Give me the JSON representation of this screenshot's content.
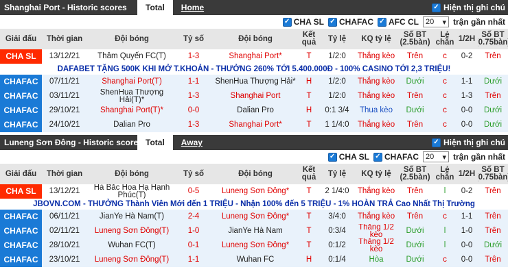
{
  "colors": {
    "cha_sl": "#ff2a00",
    "chafac": "#1a7ad6",
    "red_text": "#e00000",
    "green_text": "#2a9d2a"
  },
  "panel1": {
    "title": "Shanghai Port - Historic scores",
    "tabs": [
      "Total",
      "Home"
    ],
    "show_notes": "Hiện thị ghi chú",
    "filters": [
      "CHA SL",
      "CHAFAC",
      "AFC CL"
    ],
    "count_value": "20",
    "count_label": "trận gần nhất",
    "headers": [
      "Giải đấu",
      "Thời gian",
      "Đội bóng",
      "Tỷ số",
      "Đội bóng",
      "Kết quả",
      "Tỷ lệ",
      "KQ tỷ lệ",
      "Số BT (2.5bàn)",
      "Lẻ chẵn",
      "1/2H",
      "Số BT (0.75bàn)"
    ],
    "rows": [
      {
        "league": "CHA SL",
        "date": "13/12/21",
        "home": "Thâm Quyến FC(T)",
        "score": "1-3",
        "away": "Shanghai Port*",
        "res": "T",
        "odds": "1/2:0",
        "oddres": "Thắng kèo",
        "ou": "Trên",
        "oe": "c",
        "half": "0-2",
        "ou75": "Trên"
      },
      {
        "promo": "DAFABET TẶNG 500K KHI MỞ T.KHOẢN - THƯỞNG 260% TỚI 5.400.000Đ - 100% CASINO TỚI 2,3 TRIỆU!"
      },
      {
        "league": "CHAFAC",
        "date": "07/11/21",
        "home": "Shanghai Port(T)",
        "score": "1-1",
        "away": "ShenHua Thượng Hải*",
        "res": "H",
        "odds": "1/2:0",
        "oddres": "Thắng kèo",
        "ou": "Dưới",
        "oe": "c",
        "half": "1-1",
        "ou75": "Dưới"
      },
      {
        "league": "CHAFAC",
        "date": "03/11/21",
        "home": "ShenHua Thượng Hải(T)*",
        "score": "1-3",
        "away": "Shanghai Port",
        "res": "T",
        "odds": "1/2:0",
        "oddres": "Thắng kèo",
        "ou": "Trên",
        "oe": "c",
        "half": "1-3",
        "ou75": "Trên"
      },
      {
        "league": "CHAFAC",
        "date": "29/10/21",
        "home": "Shanghai Port(T)*",
        "score": "0-0",
        "away": "Dalian Pro",
        "res": "H",
        "odds": "0:1 3/4",
        "oddres": "Thua kèo",
        "ou": "Dưới",
        "oe": "c",
        "half": "0-0",
        "ou75": "Dưới"
      },
      {
        "league": "CHAFAC",
        "date": "24/10/21",
        "home": "Dalian Pro",
        "score": "1-3",
        "away": "Shanghai Port*",
        "res": "T",
        "odds": "1 1/4:0",
        "oddres": "Thắng kèo",
        "ou": "Trên",
        "oe": "c",
        "half": "0-0",
        "ou75": "Dưới"
      }
    ]
  },
  "panel2": {
    "title": "Luneng Sơn Đông - Historic scores",
    "tabs": [
      "Total",
      "Away"
    ],
    "show_notes": "Hiện thị ghi chú",
    "filters": [
      "CHA SL",
      "CHAFAC"
    ],
    "count_value": "20",
    "count_label": "trận gần nhất",
    "headers": [
      "Giải đấu",
      "Thời gian",
      "Đội bóng",
      "Tỷ số",
      "Đội bóng",
      "Kết quả",
      "Tỷ lệ",
      "KQ tỷ lệ",
      "Số BT (2.5bàn)",
      "Lẻ chẵn",
      "1/2H",
      "Số BT (0.75bàn)"
    ],
    "rows": [
      {
        "league": "CHA SL",
        "date": "13/12/21",
        "home": "Hà Bắc Hoa Hạ Hạnh Phúc(T)",
        "score": "0-5",
        "away": "Luneng Sơn Đông*",
        "res": "T",
        "odds": "2 1/4:0",
        "oddres": "Thắng kèo",
        "ou": "Trên",
        "oe": "l",
        "half": "0-2",
        "ou75": "Trên"
      },
      {
        "promo": "JBOVN.COM - THƯỞNG Thành Viên Mới đến 1 TRIỆU - Nhận 100% đến 5 TRIỆU - 1% HOÀN TRẢ Cao Nhất Thị Trường"
      },
      {
        "league": "CHAFAC",
        "date": "06/11/21",
        "home": "JianYe Hà Nam(T)",
        "score": "2-4",
        "away": "Luneng Sơn Đông*",
        "res": "T",
        "odds": "3/4:0",
        "oddres": "Thắng kèo",
        "ou": "Trên",
        "oe": "c",
        "half": "1-1",
        "ou75": "Trên"
      },
      {
        "league": "CHAFAC",
        "date": "02/11/21",
        "home": "Luneng Sơn Đông(T)",
        "score": "1-0",
        "away": "JianYe Hà Nam",
        "res": "T",
        "odds": "0:3/4",
        "oddres": "Thắng 1/2 kèo",
        "ou": "Dưới",
        "oe": "l",
        "half": "1-0",
        "ou75": "Trên"
      },
      {
        "league": "CHAFAC",
        "date": "28/10/21",
        "home": "Wuhan FC(T)",
        "score": "0-1",
        "away": "Luneng Sơn Đông*",
        "res": "T",
        "odds": "0:1/2",
        "oddres": "Thắng 1/2 kèo",
        "ou": "Dưới",
        "oe": "l",
        "half": "0-0",
        "ou75": "Dưới"
      },
      {
        "league": "CHAFAC",
        "date": "23/10/21",
        "home": "Luneng Sơn Đông(T)",
        "score": "1-1",
        "away": "Wuhan FC",
        "res": "H",
        "odds": "0:1/4",
        "oddres": "Hòa",
        "ou": "Dưới",
        "oe": "c",
        "half": "0-0",
        "ou75": "Trên"
      }
    ]
  }
}
